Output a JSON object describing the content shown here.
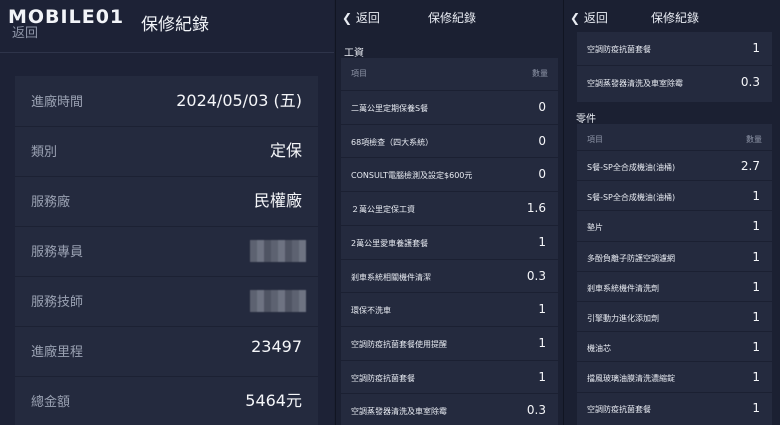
{
  "header": {
    "back_label": "返回",
    "title": "保修紀錄",
    "brand": "MOBILE01"
  },
  "summary": [
    {
      "label": "進廠時間",
      "value": "2024/05/03 (五)"
    },
    {
      "label": "類別",
      "value": "定保"
    },
    {
      "label": "服務廠",
      "value": "民權廠"
    },
    {
      "label": "服務專員",
      "value": ""
    },
    {
      "label": "服務技師",
      "value": ""
    },
    {
      "label": "進廠里程",
      "value": "23497"
    },
    {
      "label": "總金額",
      "value": "5464元"
    }
  ],
  "labor": {
    "section_title": "工資",
    "col_item": "項目",
    "col_qty": "數量",
    "rows": [
      {
        "name": "二萬公里定期保養S餐",
        "qty": "0"
      },
      {
        "name": "68項檢查（四大系統）",
        "qty": "0"
      },
      {
        "name": "CONSULT電腦檢測及設定$600元",
        "qty": "0"
      },
      {
        "name": "２萬公里定保工資",
        "qty": "1.6"
      },
      {
        "name": "2萬公里愛車養護套餐",
        "qty": "1"
      },
      {
        "name": "剎車系統相關機件清潔",
        "qty": "0.3"
      },
      {
        "name": "環保不洗車",
        "qty": "1"
      },
      {
        "name": "空調防疫抗菌套餐使用提醒",
        "qty": "1"
      },
      {
        "name": "空調防疫抗菌套餐",
        "qty": "1"
      },
      {
        "name": "空調蒸發器清洗及車室除霉",
        "qty": "0.3"
      }
    ]
  },
  "labor_continued": [
    {
      "name": "空調防疫抗菌套餐",
      "qty": "1"
    },
    {
      "name": "空調蒸發器清洗及車室除霉",
      "qty": "0.3"
    }
  ],
  "parts": {
    "section_title": "零件",
    "col_item": "項目",
    "col_qty": "數量",
    "rows": [
      {
        "name": "S餐-SP全合成機油(油桶)",
        "qty": "2.7"
      },
      {
        "name": "S餐-SP全合成機油(油桶)",
        "qty": "1"
      },
      {
        "name": "墊片",
        "qty": "1"
      },
      {
        "name": "多酚負離子防護空調濾網",
        "qty": "1"
      },
      {
        "name": "剎車系統機件清洗劑",
        "qty": "1"
      },
      {
        "name": "引擎動力進化添加劑",
        "qty": "1"
      },
      {
        "name": "機油芯",
        "qty": "1"
      },
      {
        "name": "擋風玻璃油膜清洗濃縮錠",
        "qty": "1"
      },
      {
        "name": "空調防疫抗菌套餐",
        "qty": "1"
      }
    ]
  }
}
